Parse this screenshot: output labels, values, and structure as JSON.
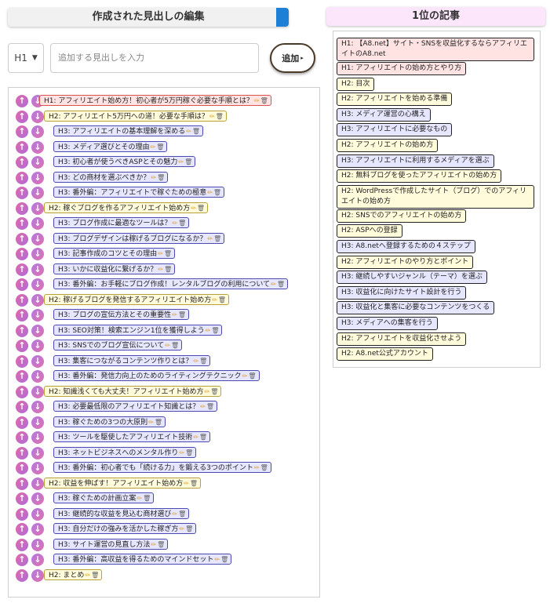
{
  "left_header": {
    "title": "作成された見出しの編集"
  },
  "right_header": {
    "title": "1位の記事"
  },
  "form": {
    "level_value": "H1",
    "input_placeholder": "追加する見出しを入力",
    "add_label": "追加"
  },
  "colors": {
    "h1_bg": "#ffe3e3",
    "h2_bg": "#fffbdb",
    "h3_bg": "#e6e6ff",
    "accent": "#1e7fd6"
  },
  "icons": {
    "edit": "pencil-icon",
    "delete": "trash-icon",
    "up": "arrow-up-icon",
    "down": "arrow-down-icon"
  },
  "headings": [
    {
      "level": "h1",
      "text": "H1: アフィリエイト始め方！初心者が5万円稼ぐ必要な手順とは？"
    },
    {
      "level": "h2",
      "text": "H2: アフィリエイト5万円への道！必要な手順は？"
    },
    {
      "level": "h3",
      "text": "H3: アフィリエイトの基本理解を深める"
    },
    {
      "level": "h3",
      "text": "H3: メディア選びとその理由"
    },
    {
      "level": "h3",
      "text": "H3: 初心者が使うべきASPとその魅力"
    },
    {
      "level": "h3",
      "text": "H3: どの商材を選ぶべきか？"
    },
    {
      "level": "h3",
      "text": "H3: 番外編：アフィリエイトで稼ぐための極意"
    },
    {
      "level": "h2",
      "text": "H2: 稼ぐブログを作るアフィリエイト始め方"
    },
    {
      "level": "h3",
      "text": "H3: ブログ作成に最適なツールは？"
    },
    {
      "level": "h3",
      "text": "H3: ブログデザインは稼げるブログになるか？"
    },
    {
      "level": "h3",
      "text": "H3: 記事作成のコツとその理由"
    },
    {
      "level": "h3",
      "text": "H3: いかに収益化に繋げるか？"
    },
    {
      "level": "h3",
      "text": "H3: 番外編：お手軽にブログ作成！レンタルブログの利用について"
    },
    {
      "level": "h2",
      "text": "H2: 稼げるブログを発信するアフィリエイト始め方"
    },
    {
      "level": "h3",
      "text": "H3: ブログの宣伝方法とその重要性"
    },
    {
      "level": "h3",
      "text": "H3: SEO対策！検索エンジン1位を獲得しよう"
    },
    {
      "level": "h3",
      "text": "H3: SNSでのブログ宣伝について"
    },
    {
      "level": "h3",
      "text": "H3: 集客につながるコンテンツ作りとは？"
    },
    {
      "level": "h3",
      "text": "H3: 番外編：発信力向上のためのライティングテクニック"
    },
    {
      "level": "h2",
      "text": "H2: 知識浅くても大丈夫！アフィリエイト始め方"
    },
    {
      "level": "h3",
      "text": "H3: 必要最低限のアフィリエイト知識とは？"
    },
    {
      "level": "h3",
      "text": "H3: 稼ぐための3つの大原則"
    },
    {
      "level": "h3",
      "text": "H3: ツールを駆使したアフィリエイト技術"
    },
    {
      "level": "h3",
      "text": "H3: ネットビジネスへのメンタル作り"
    },
    {
      "level": "h3",
      "text": "H3: 番外編：初心者でも「続ける力」を鍛える3つのポイント"
    },
    {
      "level": "h2",
      "text": "H2: 収益を伸ばす！アフィリエイト始め方"
    },
    {
      "level": "h3",
      "text": "H3: 稼ぐための計画立案"
    },
    {
      "level": "h3",
      "text": "H3: 継続的な収益を見込む商材選び"
    },
    {
      "level": "h3",
      "text": "H3: 自分だけの強みを活かした稼ぎ方"
    },
    {
      "level": "h3",
      "text": "H3: サイト運営の見直し方法"
    },
    {
      "level": "h3",
      "text": "H3: 番外編：高収益を得るためのマインドセット"
    },
    {
      "level": "h2",
      "text": "H2: まとめ"
    }
  ],
  "article": [
    {
      "level": "h1",
      "text": "H1: 【A8.net】サイト・SNSを収益化するならアフィリエイトのA8.net"
    },
    {
      "level": "h1",
      "text": "H1: アフィリエイトの始め方とやり方"
    },
    {
      "level": "h2",
      "text": "H2: 目次"
    },
    {
      "level": "h2",
      "text": "H2: アフィリエイトを始める準備"
    },
    {
      "level": "h3",
      "text": "H3: メディア運営の心構え"
    },
    {
      "level": "h3",
      "text": "H3: アフィリエイトに必要なもの"
    },
    {
      "level": "h2",
      "text": "H2: アフィリエイトの始め方"
    },
    {
      "level": "h3",
      "text": "H3: アフィリエイトに利用するメディアを選ぶ"
    },
    {
      "level": "h2",
      "text": "H2: 無料ブログを使ったアフィリエイトの始め方"
    },
    {
      "level": "h2",
      "text": "H2: WordPressで作成したサイト（ブログ）でのアフィリエイトの始め方"
    },
    {
      "level": "h2",
      "text": "H2: SNSでのアフィリエイトの始め方"
    },
    {
      "level": "h2",
      "text": "H2: ASPへの登録"
    },
    {
      "level": "h3",
      "text": "H3: A8.netへ登録するための４ステップ"
    },
    {
      "level": "h2",
      "text": "H2: アフィリエイトのやり方とポイント"
    },
    {
      "level": "h3",
      "text": "H3: 継続しやすいジャンル（テーマ）を選ぶ"
    },
    {
      "level": "h3",
      "text": "H3: 収益化に向けたサイト設計を行う"
    },
    {
      "level": "h3",
      "text": "H3: 収益化と集客に必要なコンテンツをつくる"
    },
    {
      "level": "h3",
      "text": "H3: メディアへの集客を行う"
    },
    {
      "level": "h2",
      "text": "H2: アフィリエイトを収益化させよう"
    },
    {
      "level": "h2",
      "text": "H2: A8.net公式アカウント"
    }
  ]
}
